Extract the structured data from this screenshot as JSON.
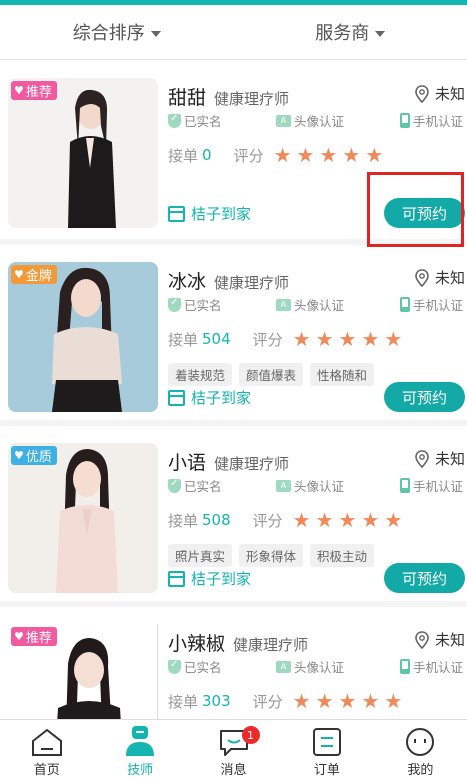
{
  "sort_bar": {
    "left_label": "综合排序",
    "right_label": "服务商"
  },
  "colors": {
    "accent": "#13b5b1",
    "star": "#f08a5a",
    "badge_pink": "#f25aa0",
    "badge_gold": "#f29a3a",
    "badge_blue": "#3fb0e6",
    "highlight": "#e02424"
  },
  "therapists": [
    {
      "name": "甜甜",
      "role": "健康理疗师",
      "badge": "推荐",
      "location": "未知",
      "verified": "已实名",
      "face": "头像认证",
      "phone": "手机认证",
      "order_label": "接单",
      "orders": "0",
      "score_label": "评分",
      "rating": 5,
      "tags": [],
      "shop": "桔子到家",
      "book": "可预约"
    },
    {
      "name": "冰冰",
      "role": "健康理疗师",
      "badge": "金牌",
      "location": "未知",
      "verified": "已实名",
      "face": "头像认证",
      "phone": "手机认证",
      "order_label": "接单",
      "orders": "504",
      "score_label": "评分",
      "rating": 5,
      "tags": [
        "着装规范",
        "颜值爆表",
        "性格随和"
      ],
      "shop": "桔子到家",
      "book": "可预约"
    },
    {
      "name": "小语",
      "role": "健康理疗师",
      "badge": "优质",
      "location": "未知",
      "verified": "已实名",
      "face": "头像认证",
      "phone": "手机认证",
      "order_label": "接单",
      "orders": "508",
      "score_label": "评分",
      "rating": 5,
      "tags": [
        "照片真实",
        "形象得体",
        "积极主动"
      ],
      "shop": "桔子到家",
      "book": "可预约"
    },
    {
      "name": "小辣椒",
      "role": "健康理疗师",
      "badge": "推荐",
      "location": "未知",
      "verified": "已实名",
      "face": "头像认证",
      "phone": "手机认证",
      "order_label": "接单",
      "orders": "303",
      "score_label": "评分",
      "rating": 5,
      "tags": [],
      "shop": "",
      "book": ""
    }
  ],
  "tabbar": {
    "tabs": [
      {
        "label": "首页",
        "icon": "home-icon"
      },
      {
        "label": "技师",
        "icon": "therapist-icon",
        "active": true
      },
      {
        "label": "消息",
        "icon": "message-icon",
        "badge": "1"
      },
      {
        "label": "订单",
        "icon": "order-icon"
      },
      {
        "label": "我的",
        "icon": "profile-icon"
      }
    ]
  }
}
